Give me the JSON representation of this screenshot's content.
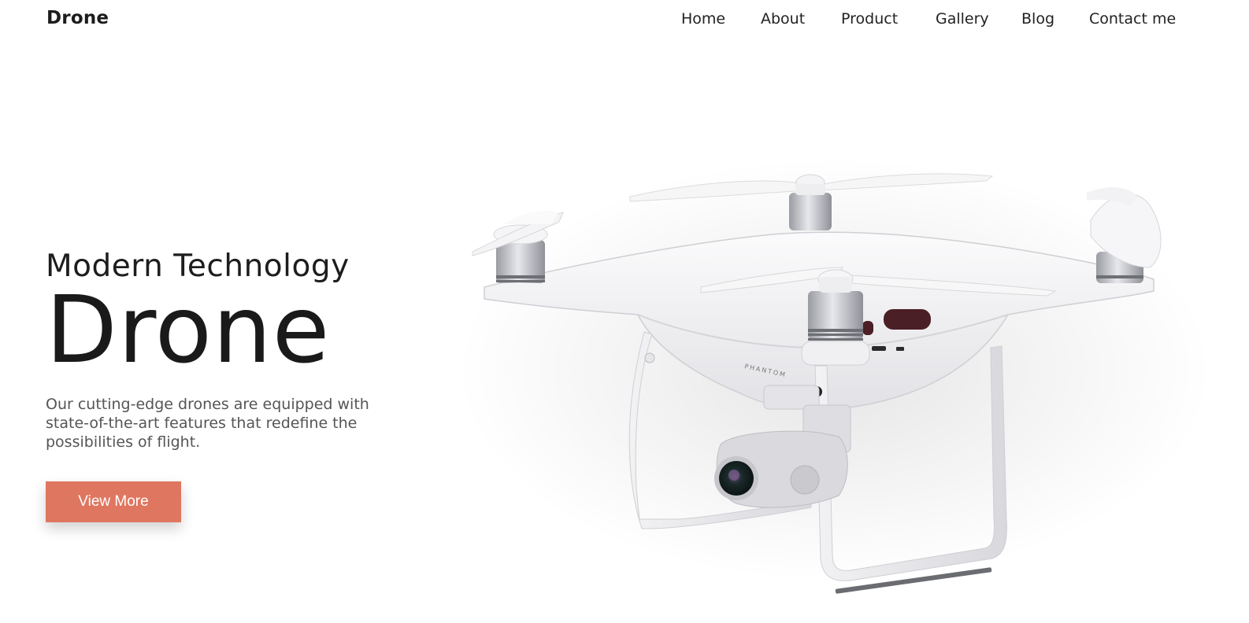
{
  "header": {
    "logo": "Drone",
    "nav": [
      "Home",
      "About",
      "Product",
      "Gallery",
      "Blog",
      "Contact me"
    ]
  },
  "hero": {
    "subtitle": "Modern Technology",
    "title": "Drone",
    "description": "Our cutting-edge drones are equipped with state-of-the-art features that redefine the possibilities of flight.",
    "button_label": "View More",
    "product_marking": "PHANTOM"
  },
  "colors": {
    "accent": "#df7660",
    "text_dark": "#1a1a1a",
    "text_muted": "#555555",
    "background": "#ffffff"
  }
}
